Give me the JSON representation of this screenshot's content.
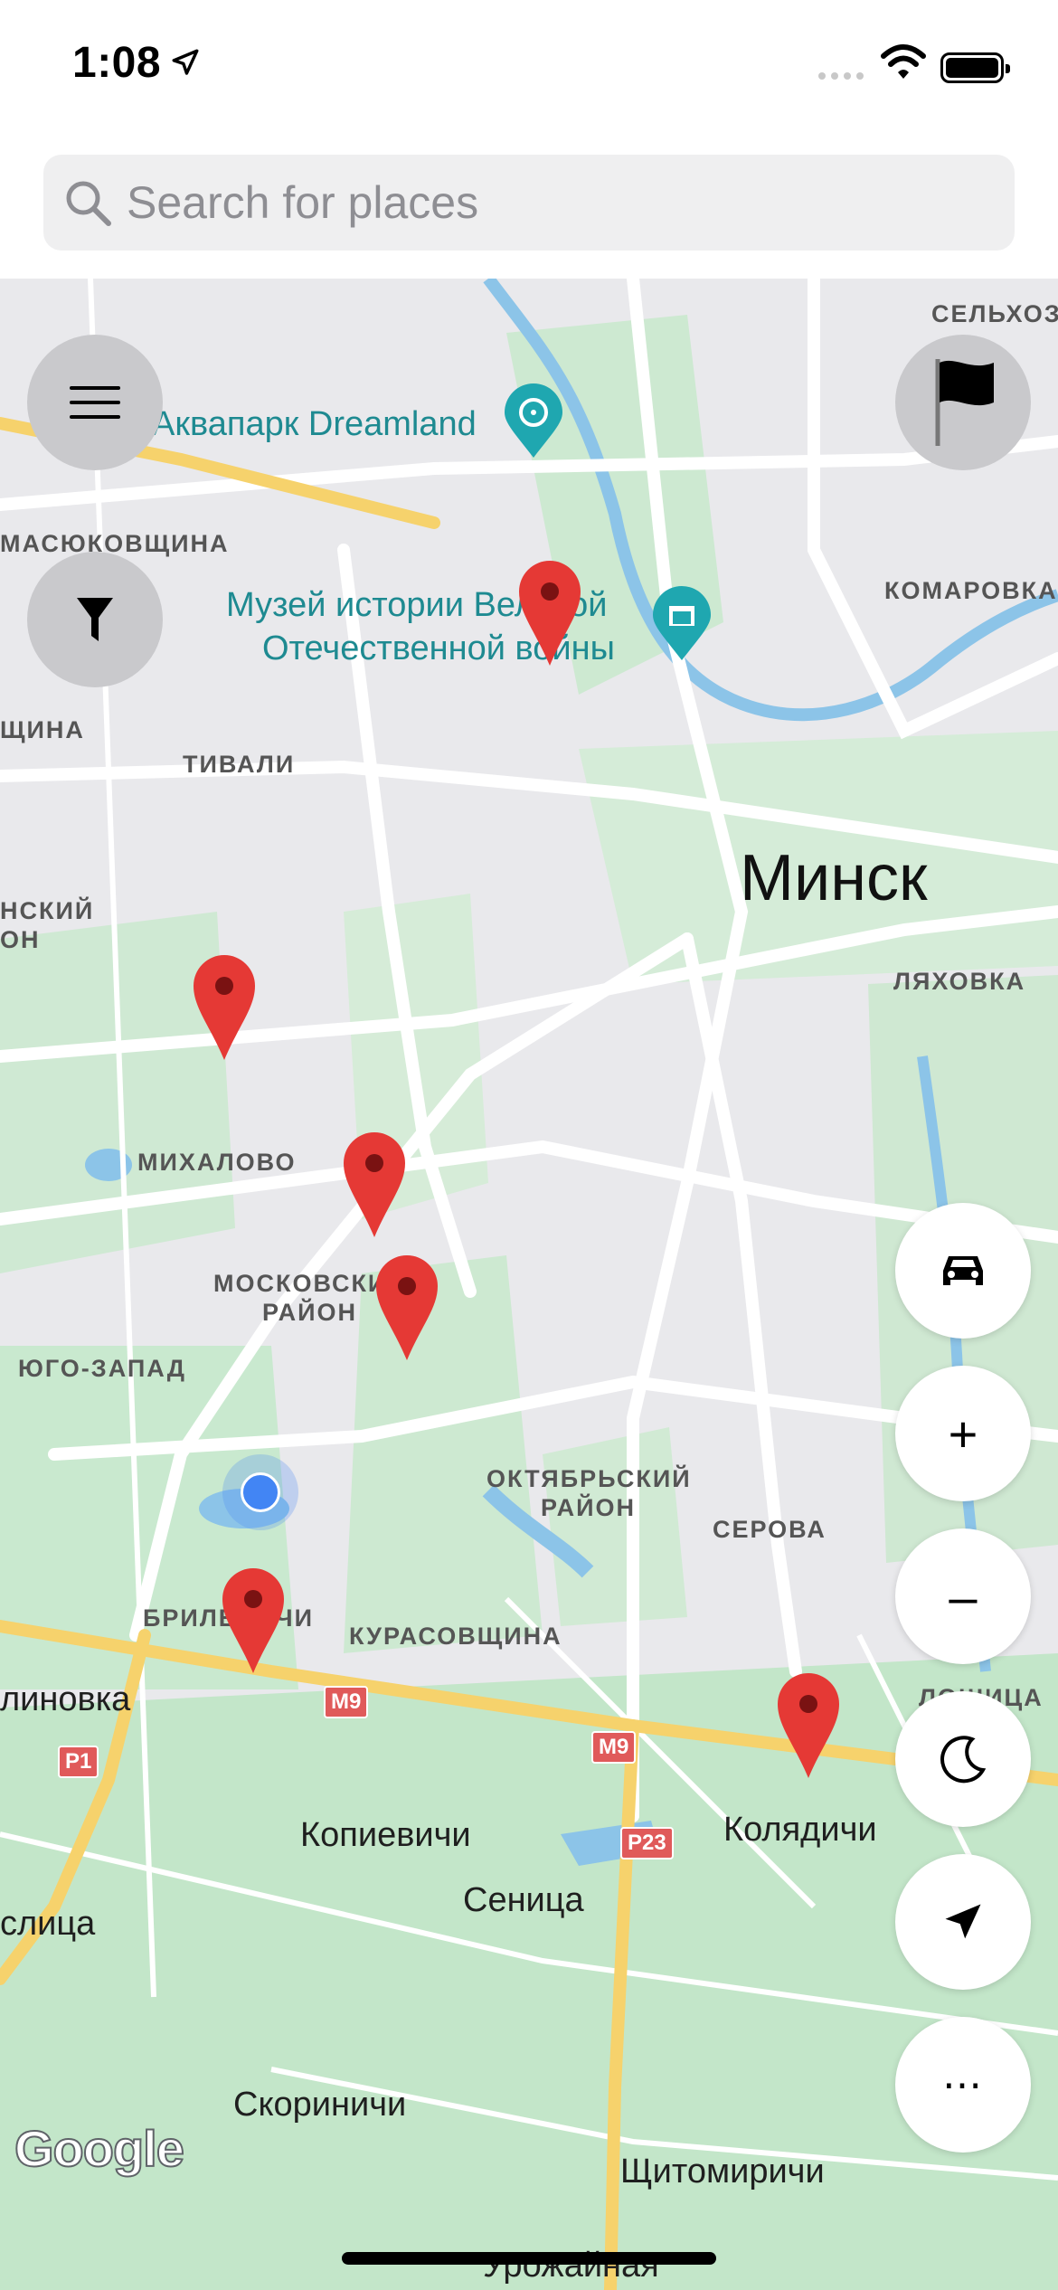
{
  "status_bar": {
    "time": "1:08"
  },
  "search": {
    "placeholder": "Search for places"
  },
  "map": {
    "city_label": "Минск",
    "poi": {
      "aquapark": "Аквапарк Dreamland",
      "museum_line1": "Музей истории Великой",
      "museum_line2": "Отечественной войны"
    },
    "districts": {
      "selkhoz": "СЕЛЬХОЗ",
      "masyukovshchina": "МАСЮКОВЩИНА",
      "komarovka": "КОМАРОВКА",
      "shchina": "ЩИНА",
      "tivali": "ТИВАЛИ",
      "nsky": "НСКИЙ",
      "on": "ОН",
      "lyakhovka": "ЛЯХОВКА",
      "mikhalovo": "МИХАЛОВО",
      "moskovsky1": "МОСКОВСКИЙ",
      "moskovsky2": "РАЙОН",
      "yugo_zapad": "ЮГО-ЗАПАД",
      "oktyabrsky1": "ОКТЯБРЬСКИЙ",
      "oktyabrsky2": "РАЙОН",
      "serova": "СЕРОВА",
      "brilevichi": "БРИЛЕВИЧИ",
      "kurasovshchina": "КУРАСОВЩИНА",
      "lošica": "ЛОШИЦА"
    },
    "towns": {
      "linovka": "линовка",
      "kopievichi": "Копиевичи",
      "kolyadichi": "Колядичи",
      "senica": "Сеница",
      "slitsa": "слица",
      "skorinichi": "Скориничи",
      "shchitomirichi": "Щитомиричи",
      "urozhainaya": "Урожайная"
    },
    "shields": {
      "m9a": "M9",
      "m9b": "M9",
      "p23": "P23",
      "p1": "P1"
    },
    "attribution": "Google"
  },
  "controls": {
    "menu": "menu-icon",
    "filter": "filter-icon",
    "flag": "flag-icon",
    "car": "car-icon",
    "zoom_in": "+",
    "zoom_out": "–",
    "night": "moon-icon",
    "locate": "navigation-arrow-icon",
    "more": "⋯"
  }
}
